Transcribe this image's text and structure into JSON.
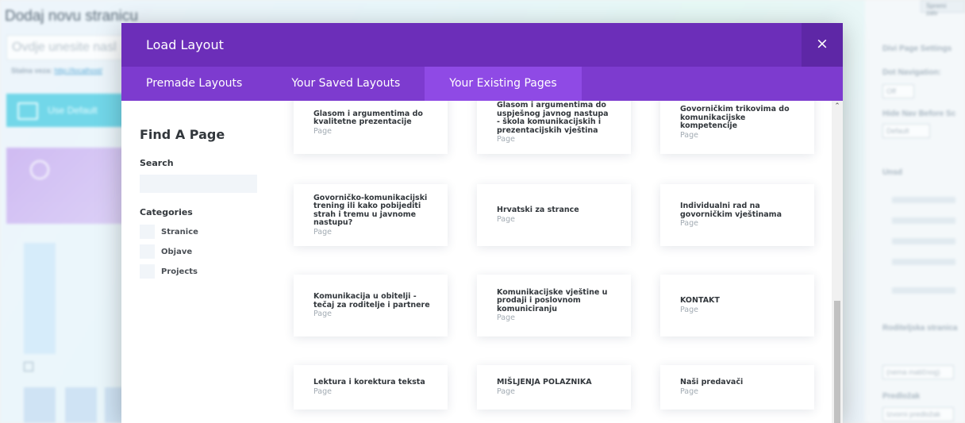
{
  "background": {
    "page_title": "Dodaj novu stranicu",
    "title_placeholder": "Ovdje unesite nasl",
    "permalink_label": "Stalna veza:",
    "permalink_url": "http://localhost/",
    "divi_button_label": "Use Default",
    "right_button": "Spremi zatv",
    "right_panel": {
      "heading": "Divi Page Settings",
      "dot_nav_label": "Dot Navigation:",
      "dot_nav_value": "Off",
      "hide_nav_label": "Hide Nav Before Sc",
      "hide_nav_value": "Default",
      "attributes_label": "Unsd",
      "parent_label": "Roditeljska stranica",
      "template_label": "Predložak",
      "template_value": "Izvorni predložak",
      "parent_value": "(nema matičnog)",
      "items": [
        "Hitro visco",
        "Izmenite Boota",
        "izmeniti",
        "Ucitajte Ivona",
        "KONTAKT"
      ]
    }
  },
  "modal": {
    "title": "Load Layout",
    "close_glyph": "×",
    "tabs": [
      {
        "label": "Premade Layouts",
        "active": false
      },
      {
        "label": "Your Saved Layouts",
        "active": false
      },
      {
        "label": "Your Existing Pages",
        "active": true
      }
    ],
    "sidebar": {
      "heading": "Find A Page",
      "search_label": "Search",
      "search_value": "",
      "categories_label": "Categories",
      "categories": [
        "Stranice",
        "Objave",
        "Projects"
      ]
    },
    "pages": [
      {
        "title": "Glasom i argumentima do kvalitetne prezentacije",
        "type": "Page"
      },
      {
        "title": "Glasom i argumentima do uspješnog javnog nastupa - škola komunikacijskih i prezentacijskih vještina",
        "type": "Page"
      },
      {
        "title": "Govorničkim trikovima do komunikacijske kompetencije",
        "type": "Page"
      },
      {
        "title": "Govorničko-komunikacijski trening ili kako pobijediti strah i tremu u javnome nastupu?",
        "type": "Page"
      },
      {
        "title": "Hrvatski za strance",
        "type": "Page"
      },
      {
        "title": "Individualni rad na govorničkim vještinama",
        "type": "Page"
      },
      {
        "title": "Komunikacija u obitelji - tečaj za roditelje i partnere",
        "type": "Page"
      },
      {
        "title": "Komunikacijske vještine u prodaji i poslovnom komuniciranju",
        "type": "Page"
      },
      {
        "title": "KONTAKT",
        "type": "Page"
      },
      {
        "title": "Lektura i korektura teksta",
        "type": "Page"
      },
      {
        "title": "MIŠLJENJA POLAZNIKA",
        "type": "Page"
      },
      {
        "title": "Naši predavači",
        "type": "Page"
      }
    ],
    "scroll_up_glyph": "⌃"
  }
}
